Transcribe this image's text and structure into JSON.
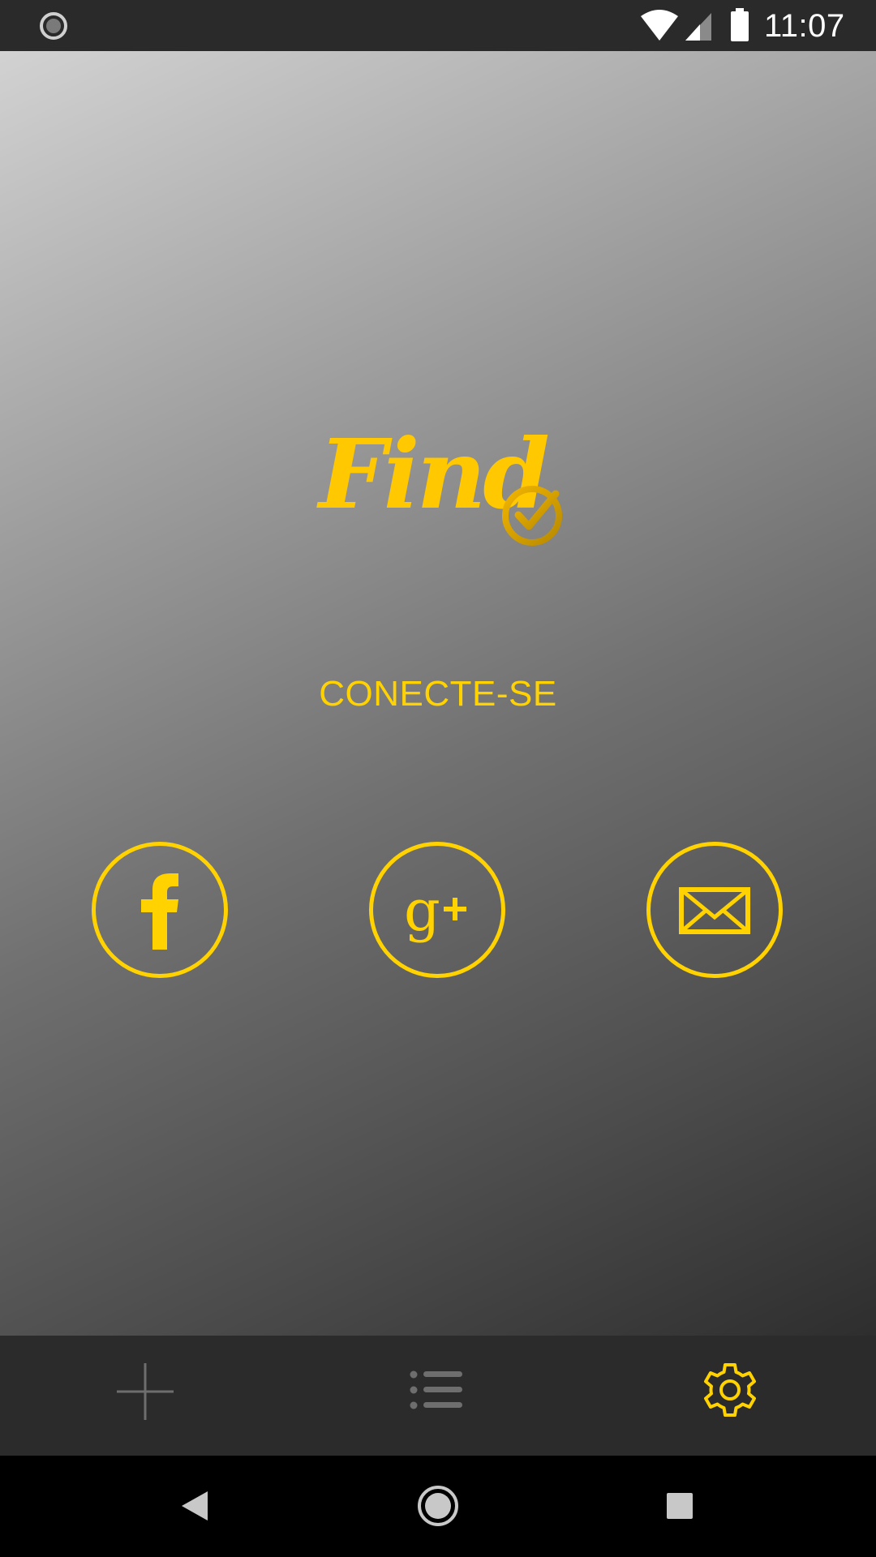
{
  "status_bar": {
    "time": "11:07",
    "icons": [
      "sync-icon",
      "wifi-icon",
      "cell-signal-icon",
      "battery-icon"
    ]
  },
  "logo": {
    "text": "Find",
    "icon": "check-circle-icon"
  },
  "connect": {
    "label": "CONECTE-SE"
  },
  "social_buttons": [
    {
      "icon": "facebook-icon"
    },
    {
      "icon": "google-plus-icon"
    },
    {
      "icon": "email-icon"
    }
  ],
  "bottom_nav": {
    "items": [
      {
        "icon": "plus-icon",
        "active": false
      },
      {
        "icon": "list-icon",
        "active": false
      },
      {
        "icon": "gear-icon",
        "active": true
      }
    ]
  },
  "system_nav": {
    "icons": [
      "back-icon",
      "home-icon",
      "recents-icon"
    ]
  },
  "colors": {
    "accent": "#ffd200",
    "status_bar_bg": "#2a2a2a",
    "bottom_nav_bg": "#2b2b2b",
    "inactive_icon": "#6e6e6e"
  }
}
